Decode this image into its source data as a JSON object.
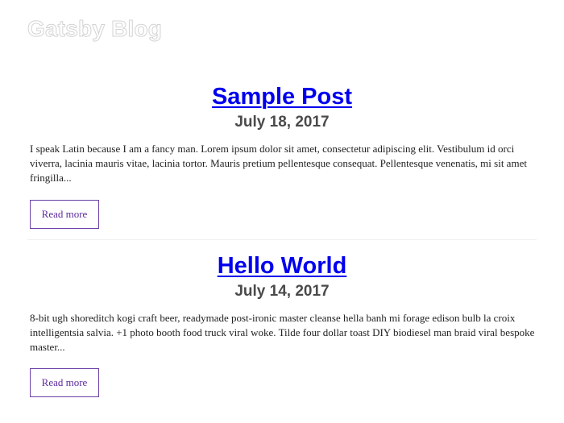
{
  "site": {
    "title": "Gatsby Blog"
  },
  "posts": [
    {
      "title": "Sample Post",
      "date": "July 18, 2017",
      "excerpt": "I speak Latin because I am a fancy man. Lorem ipsum dolor sit amet, consectetur adipiscing elit. Vestibulum id orci viverra, lacinia mauris vitae, lacinia tortor. Mauris pretium pellentesque consequat. Pellentesque venenatis, mi sit amet fringilla...",
      "read_more_label": "Read more"
    },
    {
      "title": "Hello World",
      "date": "July 14, 2017",
      "excerpt": "8-bit ugh shoreditch kogi craft beer, readymade post-ironic master cleanse hella banh mi forage edison bulb la croix intelligentsia salvia. +1 photo booth food truck viral woke. Tilde four dollar toast DIY biodiesel man braid viral bespoke master...",
      "read_more_label": "Read more"
    }
  ],
  "colors": {
    "link": "#0000ee",
    "date": "#4a4a4a",
    "button_border": "#6a3fa8",
    "button_text": "#5b2a9e"
  }
}
